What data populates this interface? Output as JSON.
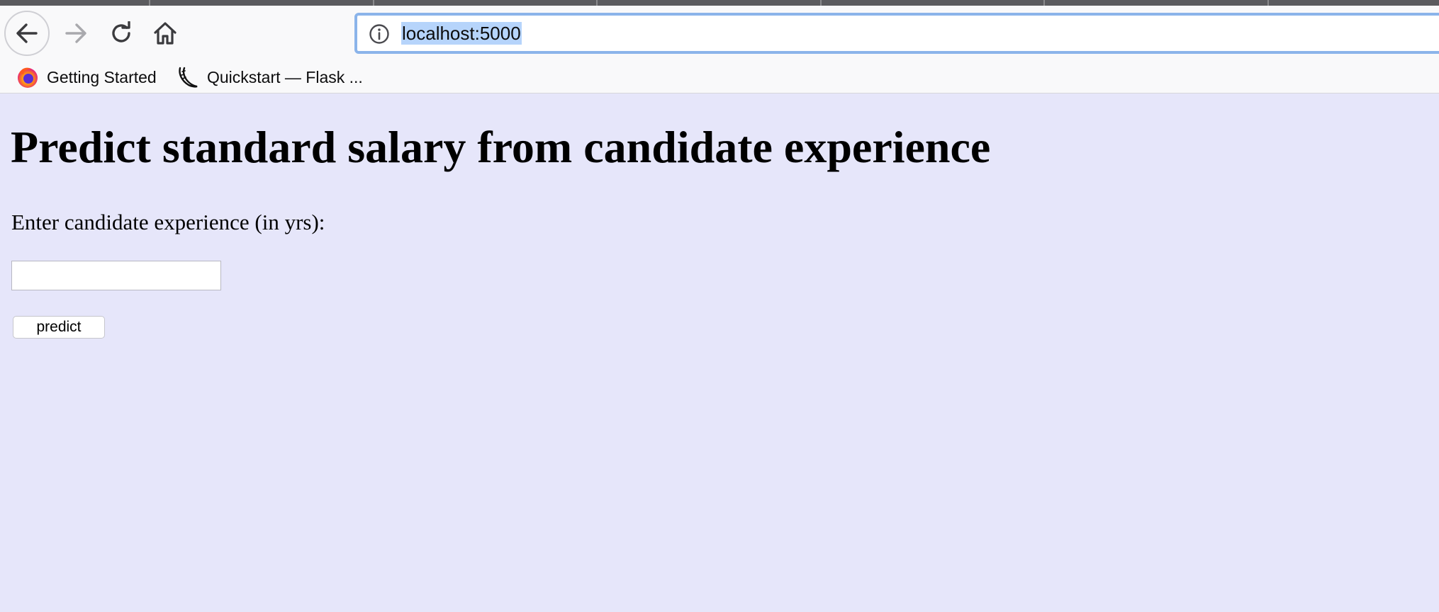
{
  "browser": {
    "url": "localhost:5000",
    "bookmarks": [
      {
        "label": "Getting Started",
        "icon": "firefox-icon"
      },
      {
        "label": "Quickstart — Flask ...",
        "icon": "flask-icon"
      }
    ]
  },
  "page": {
    "title": "Predict standard salary from candidate experience",
    "experience_label": "Enter candidate experience (in yrs):",
    "experience_value": "",
    "predict_label": "predict"
  },
  "colors": {
    "page_background": "#e6e6fa",
    "url_focus_border": "#8bb4ea",
    "url_selection": "#b6d4fb"
  }
}
